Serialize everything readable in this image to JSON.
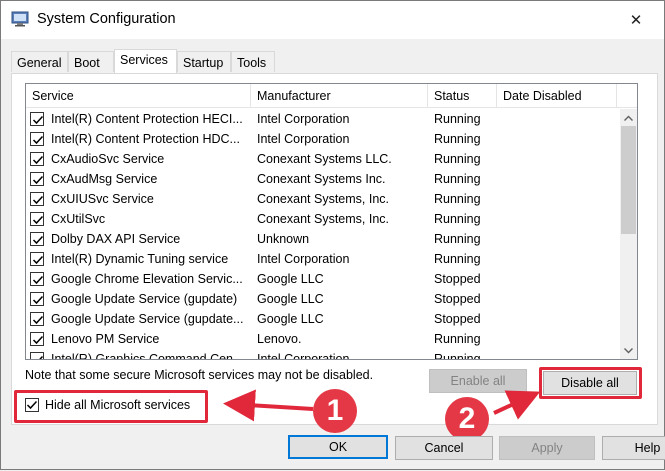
{
  "window": {
    "title": "System Configuration",
    "close_glyph": "✕"
  },
  "tabs": [
    {
      "label": "General"
    },
    {
      "label": "Boot"
    },
    {
      "label": "Services"
    },
    {
      "label": "Startup"
    },
    {
      "label": "Tools"
    }
  ],
  "list": {
    "columns": [
      "Service",
      "Manufacturer",
      "Status",
      "Date Disabled"
    ],
    "rows": [
      {
        "service": "Intel(R) Content Protection HECI...",
        "manufacturer": "Intel Corporation",
        "status": "Running",
        "checked": true
      },
      {
        "service": "Intel(R) Content Protection HDC...",
        "manufacturer": "Intel Corporation",
        "status": "Running",
        "checked": true
      },
      {
        "service": "CxAudioSvc Service",
        "manufacturer": "Conexant Systems LLC.",
        "status": "Running",
        "checked": true
      },
      {
        "service": "CxAudMsg Service",
        "manufacturer": "Conexant Systems Inc.",
        "status": "Running",
        "checked": true
      },
      {
        "service": "CxUIUSvc Service",
        "manufacturer": "Conexant Systems, Inc.",
        "status": "Running",
        "checked": true
      },
      {
        "service": "CxUtilSvc",
        "manufacturer": "Conexant Systems, Inc.",
        "status": "Running",
        "checked": true
      },
      {
        "service": "Dolby DAX API Service",
        "manufacturer": "Unknown",
        "status": "Running",
        "checked": true
      },
      {
        "service": "Intel(R) Dynamic Tuning service",
        "manufacturer": "Intel Corporation",
        "status": "Running",
        "checked": true
      },
      {
        "service": "Google Chrome Elevation Servic...",
        "manufacturer": "Google LLC",
        "status": "Stopped",
        "checked": true
      },
      {
        "service": "Google Update Service (gupdate)",
        "manufacturer": "Google LLC",
        "status": "Stopped",
        "checked": true
      },
      {
        "service": "Google Update Service (gupdate...",
        "manufacturer": "Google LLC",
        "status": "Stopped",
        "checked": true
      },
      {
        "service": "Lenovo PM Service",
        "manufacturer": "Lenovo.",
        "status": "Running",
        "checked": true
      },
      {
        "service": "Intel(R) Graphics Command Cen...",
        "manufacturer": "Intel Corporation",
        "status": "Running",
        "checked": true
      }
    ]
  },
  "note": "Note that some secure Microsoft services may not be disabled.",
  "enable_all_label": "Enable all",
  "disable_all_label": "Disable all",
  "hide_ms": {
    "label": "Hide all Microsoft services",
    "checked": true
  },
  "annotations": {
    "badge_1": "1",
    "badge_2": "2",
    "color": "#e0283a"
  },
  "buttons": {
    "ok": "OK",
    "cancel": "Cancel",
    "apply": "Apply",
    "help": "Help"
  }
}
